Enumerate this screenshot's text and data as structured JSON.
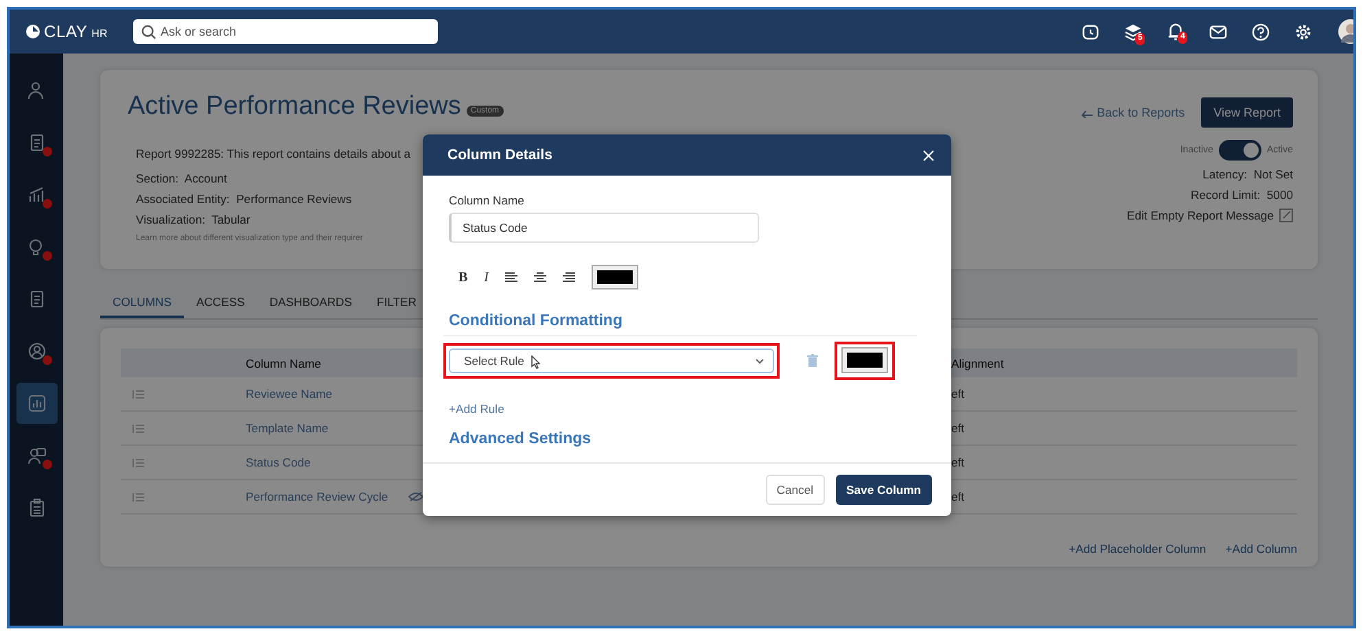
{
  "topbar": {
    "logo": "CLAY",
    "logo_suffix": "HR",
    "search": {
      "placeholder": "Ask or search"
    },
    "icons": [
      {
        "kind": "alarm"
      },
      {
        "kind": "stack",
        "badge": "5"
      },
      {
        "kind": "bell",
        "badge": "4"
      },
      {
        "kind": "mail"
      },
      {
        "kind": "help"
      },
      {
        "kind": "settings"
      },
      {
        "kind": "avatar"
      }
    ]
  },
  "sidebar": {
    "items": [
      {
        "kind": "people",
        "selected": false,
        "alert": false
      },
      {
        "kind": "document",
        "selected": false,
        "alert": true
      },
      {
        "kind": "chart",
        "selected": false,
        "alert": true
      },
      {
        "kind": "bulb",
        "selected": false,
        "alert": true
      },
      {
        "kind": "files",
        "selected": false,
        "alert": false
      },
      {
        "kind": "person",
        "selected": false,
        "alert": true
      },
      {
        "kind": "report",
        "selected": true,
        "alert": false
      },
      {
        "kind": "team",
        "selected": false,
        "alert": true
      },
      {
        "kind": "clipboard",
        "selected": false,
        "alert": false
      }
    ]
  },
  "report": {
    "title": "Active Performance Reviews",
    "badge": "Custom",
    "description": "Report 9992285: This report contains details about a",
    "details": [
      {
        "label": "Section:",
        "value": "Account"
      },
      {
        "label": "Associated Entity:",
        "value": "Performance Reviews"
      },
      {
        "label": "Visualization:",
        "value": "Tabular"
      }
    ],
    "note": "Learn more about different visualization type and their requirer",
    "back_link": "Back to Reports",
    "view_button": "View Report",
    "toggle": {
      "off_label": "Inactive",
      "on_label": "Active",
      "on": true
    },
    "settings": [
      {
        "label": "Latency:",
        "value": "Not Set"
      },
      {
        "label": "Record Limit:",
        "value": "5000"
      }
    ],
    "edit_message": "Edit Empty Report Message"
  },
  "tabs": [
    {
      "label": "COLUMNS",
      "selected": true
    },
    {
      "label": "ACCESS",
      "selected": false
    },
    {
      "label": "DASHBOARDS",
      "selected": false
    },
    {
      "label": "FILTER",
      "selected": false
    }
  ],
  "table": {
    "columns": [
      "Column Name",
      "Alignment"
    ],
    "rows": [
      {
        "name": "Reviewee Name",
        "alignment": "eft",
        "hidden": false
      },
      {
        "name": "Template Name",
        "alignment": "eft",
        "hidden": false
      },
      {
        "name": "Status Code",
        "alignment": "eft",
        "hidden": false
      },
      {
        "name": "Performance Review Cycle",
        "alignment": "eft",
        "hidden": true
      }
    ],
    "links": [
      "+Add Placeholder Column",
      "+Add Column"
    ]
  },
  "modal": {
    "title": "Column Details",
    "column_name_label": "Column Name",
    "column_name": "Status Code",
    "format_tools": [
      {
        "kind": "bold",
        "label": "B"
      },
      {
        "kind": "italic",
        "label": "I"
      },
      {
        "kind": "align-left"
      },
      {
        "kind": "align-center"
      },
      {
        "kind": "align-right"
      }
    ],
    "conditional_heading": "Conditional Formatting",
    "rule_select": {
      "placeholder": "Select Rule"
    },
    "add_rule": "+Add Rule",
    "advanced_heading": "Advanced Settings",
    "buttons": [
      "Cancel",
      "Save Column"
    ]
  }
}
